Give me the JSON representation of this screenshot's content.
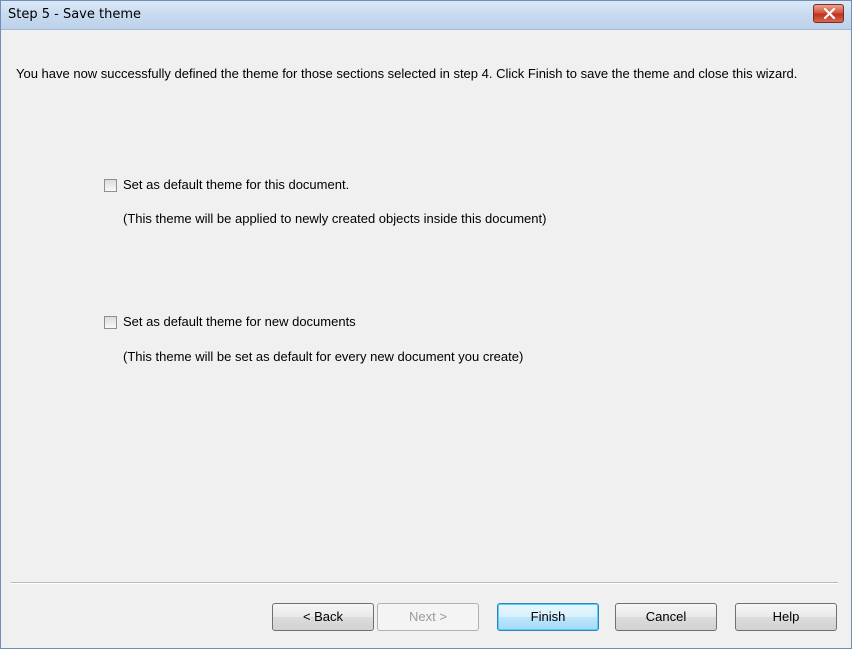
{
  "window": {
    "title": "Step 5 - Save theme"
  },
  "intro": {
    "text": "You have now successfully defined the theme for those sections selected in step 4. Click Finish to save the theme and close this wizard."
  },
  "options": [
    {
      "label": "Set as default theme for this document.",
      "note": "(This theme will be applied to newly created objects inside this document)",
      "checked": false
    },
    {
      "label": "Set as default theme for new documents",
      "note": "(This theme will be set as default for every new document you create)",
      "checked": false
    }
  ],
  "buttons": {
    "back": "< Back",
    "next": "Next >",
    "finish": "Finish",
    "cancel": "Cancel",
    "help": "Help"
  },
  "colors": {
    "close_button": "#c9432c",
    "dialog_background": "#f0f0f0"
  }
}
